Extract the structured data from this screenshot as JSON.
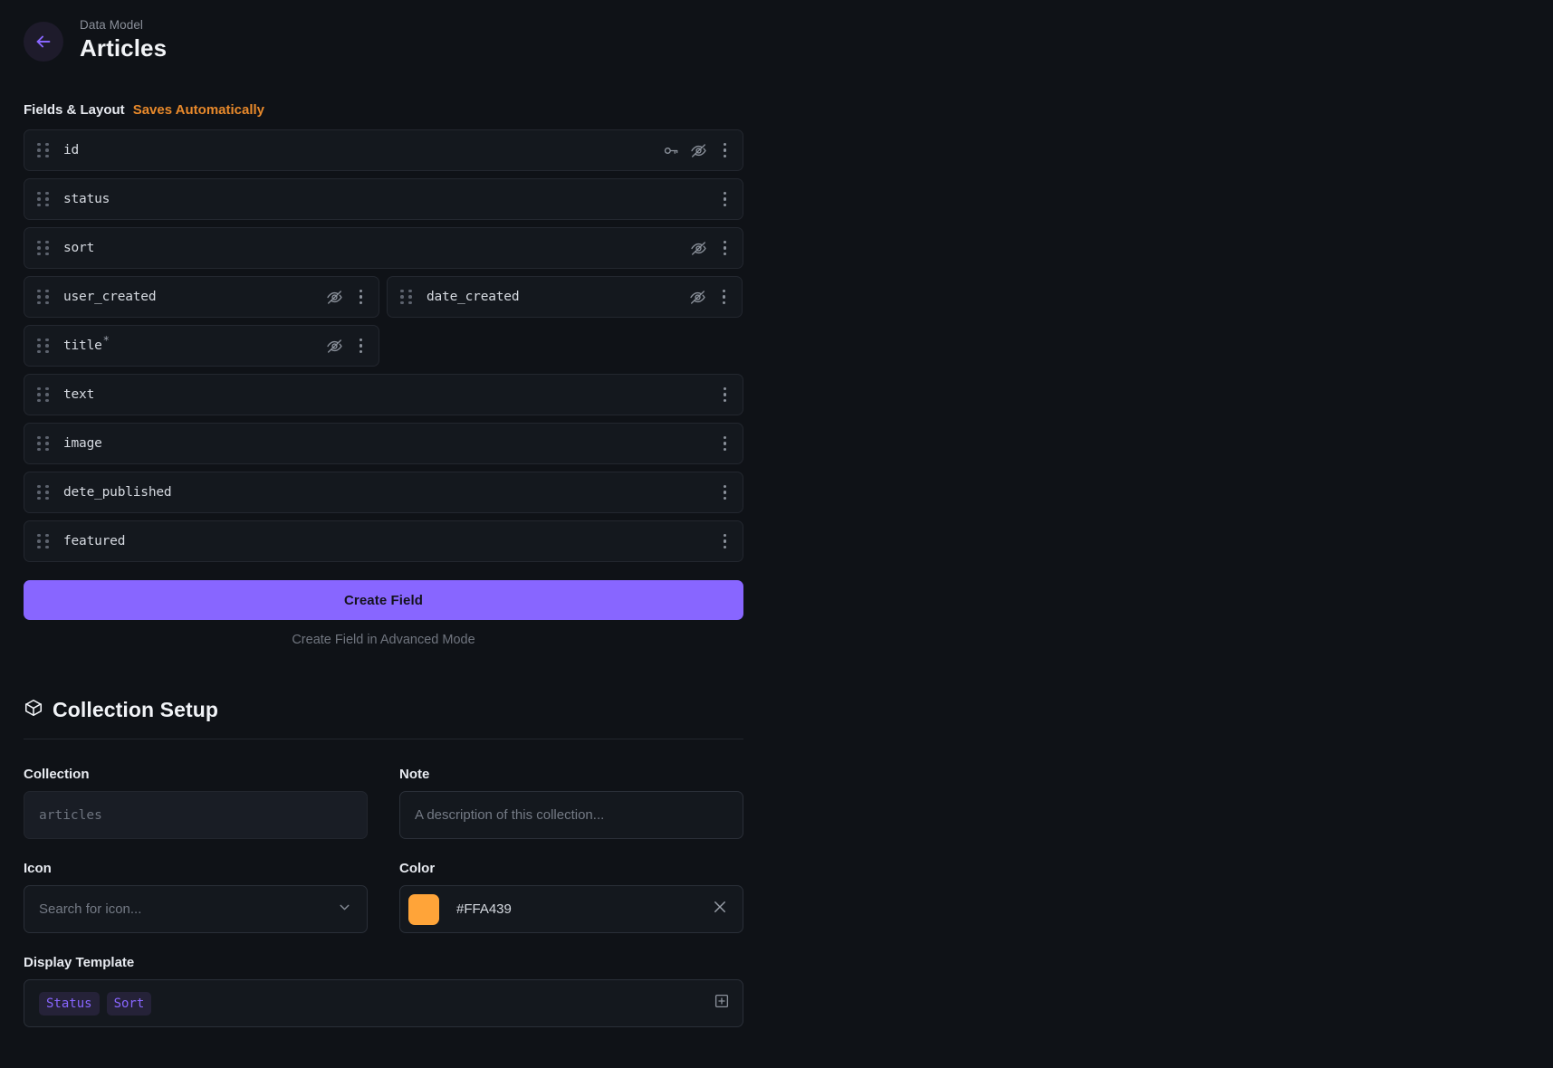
{
  "header": {
    "back_icon": "arrow-left-icon",
    "eyebrow": "Data Model",
    "title": "Articles"
  },
  "fields_section": {
    "label": "Fields & Layout",
    "saves_note": "Saves Automatically",
    "accent_saves_color": "#E8892B",
    "rows": [
      {
        "name": "id",
        "width": "full",
        "required": false,
        "icons": [
          "key-icon",
          "eye-off-icon",
          "kebab-menu-icon"
        ]
      },
      {
        "name": "status",
        "width": "full",
        "required": false,
        "icons": [
          "kebab-menu-icon"
        ]
      },
      {
        "name": "sort",
        "width": "full",
        "required": false,
        "icons": [
          "eye-off-icon",
          "kebab-menu-icon"
        ]
      },
      {
        "name": "user_created",
        "width": "half",
        "required": false,
        "icons": [
          "eye-off-icon",
          "kebab-menu-icon"
        ]
      },
      {
        "name": "date_created",
        "width": "half",
        "required": false,
        "icons": [
          "eye-off-icon",
          "kebab-menu-icon"
        ]
      },
      {
        "name": "title",
        "width": "half",
        "required": true,
        "icons": [
          "eye-off-icon",
          "kebab-menu-icon"
        ]
      },
      {
        "name": "text",
        "width": "full",
        "required": false,
        "icons": [
          "kebab-menu-icon"
        ]
      },
      {
        "name": "image",
        "width": "full",
        "required": false,
        "icons": [
          "kebab-menu-icon"
        ]
      },
      {
        "name": "dete_published",
        "width": "full",
        "required": false,
        "icons": [
          "kebab-menu-icon"
        ]
      },
      {
        "name": "featured",
        "width": "full",
        "required": false,
        "icons": [
          "kebab-menu-icon"
        ]
      }
    ],
    "required_marker": "*",
    "create_button": "Create Field",
    "create_button_color": "#8866FF",
    "advanced_link": "Create Field in Advanced Mode"
  },
  "collection_setup": {
    "icon": "box-icon",
    "title": "Collection Setup",
    "collection": {
      "label": "Collection",
      "value": "articles",
      "disabled": true
    },
    "note": {
      "label": "Note",
      "value": "",
      "placeholder": "A description of this collection..."
    },
    "icon_field": {
      "label": "Icon",
      "value": "",
      "placeholder": "Search for icon...",
      "chevron_icon": "chevron-down-icon"
    },
    "color_field": {
      "label": "Color",
      "value": "#FFA439",
      "swatch": "#FFA439",
      "clear_icon": "close-icon"
    },
    "display_template": {
      "label": "Display Template",
      "chips": [
        "Status",
        "Sort"
      ],
      "chip_color": "#8866FF",
      "add_icon": "plus-box-icon"
    }
  }
}
